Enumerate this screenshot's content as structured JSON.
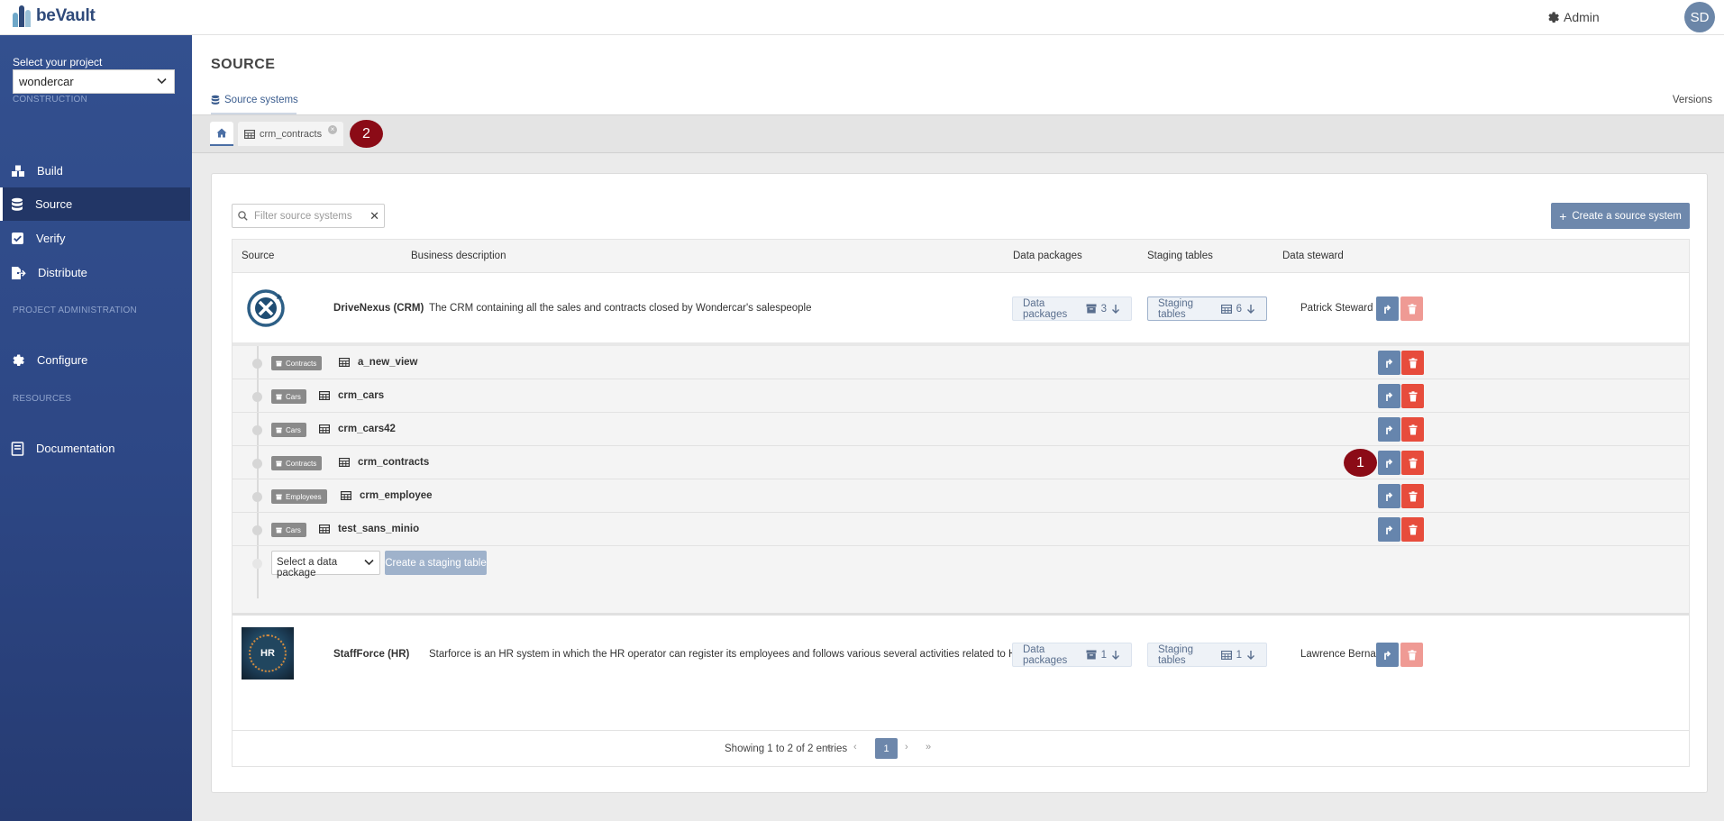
{
  "topbar": {
    "brand": "beVault",
    "admin_label": "Admin",
    "user_initials": "SD"
  },
  "sidebar": {
    "project_label": "Select your project",
    "project_value": "wondercar",
    "sections": {
      "construction": "CONSTRUCTION",
      "admin": "PROJECT ADMINISTRATION",
      "resources": "RESOURCES"
    },
    "items": [
      {
        "label": "Build",
        "icon": "cubes-icon"
      },
      {
        "label": "Source",
        "icon": "database-icon",
        "active": true
      },
      {
        "label": "Verify",
        "icon": "check-square-icon"
      },
      {
        "label": "Distribute",
        "icon": "file-export-icon"
      },
      {
        "label": "Configure",
        "icon": "gear-icon"
      },
      {
        "label": "Documentation",
        "icon": "book-icon"
      }
    ]
  },
  "header": {
    "title": "SOURCE",
    "tab_label": "Source systems",
    "versions_label": "Versions"
  },
  "open_tabs": [
    {
      "label": "crm_contracts"
    }
  ],
  "markers": [
    "1",
    "2"
  ],
  "toolbar": {
    "filter_placeholder": "Filter source systems",
    "create_label": "Create a source system"
  },
  "table": {
    "columns": [
      "Source",
      "Business description",
      "Data packages",
      "Staging tables",
      "Data steward"
    ],
    "rows": [
      {
        "name": "DriveNexus (CRM)",
        "description": "The CRM containing all the sales and contracts closed by Wondercar's salespeople",
        "data_packages_label": "Data packages",
        "data_packages_count": "3",
        "staging_tables_label": "Staging tables",
        "staging_tables_count": "6",
        "steward": "Patrick Steward"
      },
      {
        "name": "StaffForce (HR)",
        "description": "Starforce is an HR system in which the HR operator can register its employees and follows various several activities related to HR management",
        "data_packages_label": "Data packages",
        "data_packages_count": "1",
        "staging_tables_label": "Staging tables",
        "staging_tables_count": "1",
        "steward": "Lawrence Bernard",
        "logo_text": "HR"
      }
    ],
    "staging_tables": [
      {
        "package": "Contracts",
        "name": "a_new_view"
      },
      {
        "package": "Cars",
        "name": "crm_cars"
      },
      {
        "package": "Cars",
        "name": "crm_cars42"
      },
      {
        "package": "Contracts",
        "name": "crm_contracts"
      },
      {
        "package": "Employees",
        "name": "crm_employee"
      },
      {
        "package": "Cars",
        "name": "test_sans_minio"
      }
    ],
    "add_row": {
      "select_placeholder": "Select a data package",
      "create_label": "Create a staging table"
    },
    "pagination": {
      "info": "Showing 1 to 2 of 2 entries",
      "first": "«",
      "prev": "‹",
      "current": "1",
      "next": "›",
      "last": "»"
    }
  },
  "colors": {
    "sidebar": "#2d4785",
    "primary_button": "#6685ad",
    "danger_button": "#e74c3c",
    "marker": "#8b0b16"
  }
}
